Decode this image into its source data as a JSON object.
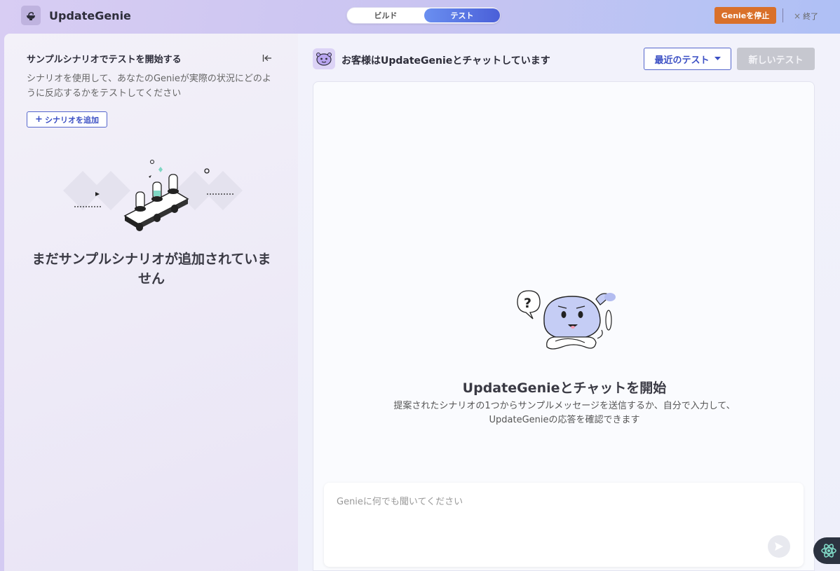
{
  "app": {
    "title": "UpdateGenie",
    "logo_icon": "genie-lamp-icon"
  },
  "mode_toggle": {
    "options": [
      {
        "label": "ビルド",
        "active": false
      },
      {
        "label": "テスト",
        "active": true
      }
    ]
  },
  "top_actions": {
    "stop_label": "Genieを停止",
    "exit_label": "終了",
    "exit_icon": "close-icon"
  },
  "colors": {
    "accent": "#4a5fd8",
    "stop_button": "#d9702a",
    "disabled_button": "#c6c7cf"
  },
  "scenarios": {
    "title": "サンプルシナリオでテストを開始する",
    "description": "シナリオを使用して、あなたのGenieが実際の状況にどのように反応するかをテストしてください",
    "add_label": "シナリオを追加",
    "add_icon": "plus-icon",
    "collapse_icon": "collapse-left-icon",
    "empty_text": "まだサンプルシナリオが追加されていません"
  },
  "chat": {
    "header": "お客様はUpdateGenieとチャットしています",
    "recent_tests_label": "最近のテスト",
    "new_test_label": "新しいテスト",
    "empty_title": "UpdateGenieとチャットを開始",
    "empty_description": "提案されたシナリオの1つからサンプルメッセージを送信するか、自分で入力して、UpdateGenieの応答を確認できます",
    "input_placeholder": "Genieに何でも聞いてください",
    "input_value": "",
    "send_icon": "send-icon"
  },
  "floating": {
    "icon": "atom-icon"
  }
}
